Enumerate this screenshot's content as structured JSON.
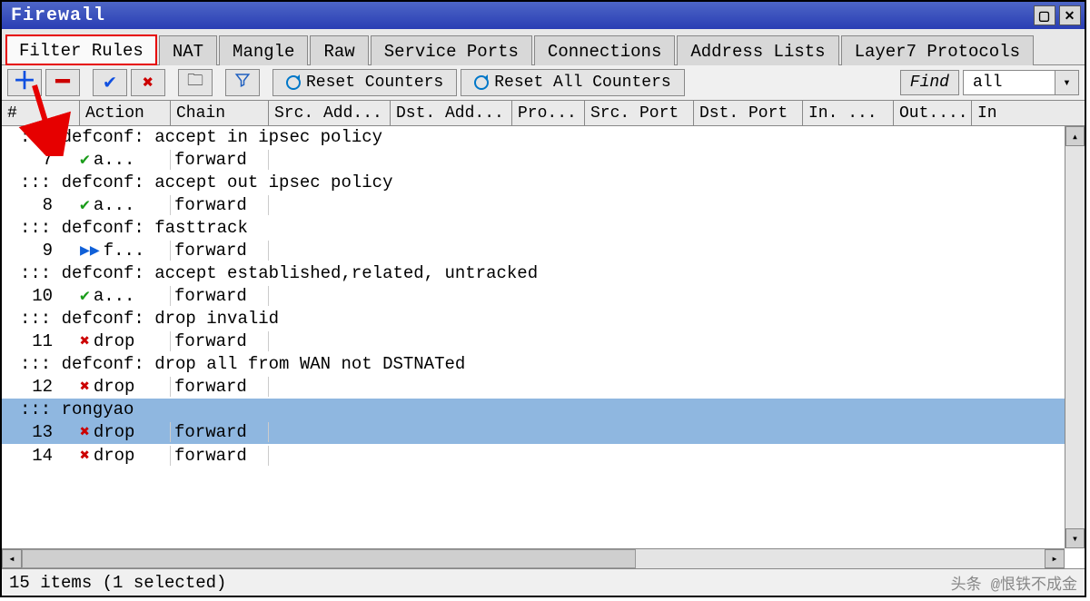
{
  "window": {
    "title": "Firewall"
  },
  "tabs": [
    {
      "label": "Filter Rules",
      "active": true,
      "highlight": true
    },
    {
      "label": "NAT"
    },
    {
      "label": "Mangle"
    },
    {
      "label": "Raw"
    },
    {
      "label": "Service Ports"
    },
    {
      "label": "Connections"
    },
    {
      "label": "Address Lists"
    },
    {
      "label": "Layer7 Protocols"
    }
  ],
  "toolbar": {
    "reset_counters": "Reset Counters",
    "reset_all_counters": "Reset All Counters",
    "find_label": "Find",
    "filter_value": "all"
  },
  "columns": {
    "num": "#",
    "action": "Action",
    "chain": "Chain",
    "src_addr": "Src. Add...",
    "dst_addr": "Dst. Add...",
    "proto": "Pro...",
    "src_port": "Src. Port",
    "dst_port": "Dst. Port",
    "in": "In. ...",
    "out": "Out....",
    "last": "In"
  },
  "rows": [
    {
      "type": "comment",
      "text": "::: defconf: accept in ipsec policy"
    },
    {
      "type": "rule",
      "num": "7",
      "action_icon": "accept",
      "action": "a...",
      "chain": "forward"
    },
    {
      "type": "comment",
      "text": "::: defconf: accept out ipsec policy"
    },
    {
      "type": "rule",
      "num": "8",
      "action_icon": "accept",
      "action": "a...",
      "chain": "forward"
    },
    {
      "type": "comment",
      "text": "::: defconf: fasttrack"
    },
    {
      "type": "rule",
      "num": "9",
      "action_icon": "fast",
      "action": "f...",
      "chain": "forward"
    },
    {
      "type": "comment",
      "text": "::: defconf: accept established,related, untracked"
    },
    {
      "type": "rule",
      "num": "10",
      "action_icon": "accept",
      "action": "a...",
      "chain": "forward"
    },
    {
      "type": "comment",
      "text": "::: defconf: drop invalid"
    },
    {
      "type": "rule",
      "num": "11",
      "action_icon": "drop",
      "action": "drop",
      "chain": "forward"
    },
    {
      "type": "comment",
      "text": "::: defconf: drop all from WAN not DSTNATed"
    },
    {
      "type": "rule",
      "num": "12",
      "action_icon": "drop",
      "action": "drop",
      "chain": "forward"
    },
    {
      "type": "comment",
      "text": "::: rongyao",
      "selected": true
    },
    {
      "type": "rule",
      "num": "13",
      "action_icon": "drop",
      "action": "drop",
      "chain": "forward",
      "selected": true
    },
    {
      "type": "rule",
      "num": "14",
      "action_icon": "drop",
      "action": "drop",
      "chain": "forward"
    }
  ],
  "status": {
    "text": "15 items (1 selected)",
    "watermark": "头条 @恨铁不成金"
  }
}
